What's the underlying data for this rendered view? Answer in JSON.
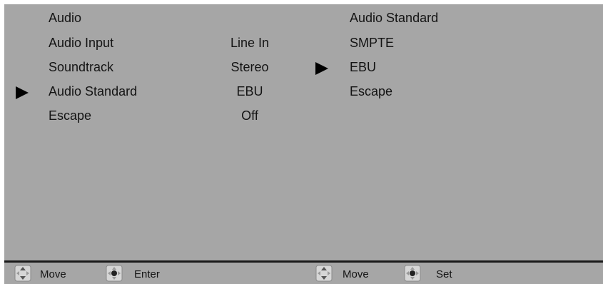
{
  "left_menu": {
    "title": "Audio",
    "items": [
      {
        "label": "Audio Input",
        "value": "Line In",
        "selected": false
      },
      {
        "label": "Soundtrack",
        "value": "Stereo",
        "selected": false
      },
      {
        "label": "Audio Standard",
        "value": "EBU",
        "selected": true
      },
      {
        "label": "Escape",
        "value": "Off",
        "selected": false
      }
    ],
    "hints": [
      {
        "icon": "dpad-updown-icon",
        "label": "Move"
      },
      {
        "icon": "dpad-center-icon",
        "label": "Enter"
      }
    ]
  },
  "right_menu": {
    "title": "Audio Standard",
    "items": [
      {
        "label": "SMPTE",
        "selected": false
      },
      {
        "label": "EBU",
        "selected": true
      },
      {
        "label": "Escape",
        "selected": false
      }
    ],
    "hints": [
      {
        "icon": "dpad-updown-icon",
        "label": "Move"
      },
      {
        "icon": "dpad-center-icon",
        "label": "Set"
      }
    ]
  },
  "colors": {
    "panel_bg": "#a6a6a6",
    "text": "#141414",
    "pointer": "#000000",
    "divider": "#1a1a1a"
  }
}
